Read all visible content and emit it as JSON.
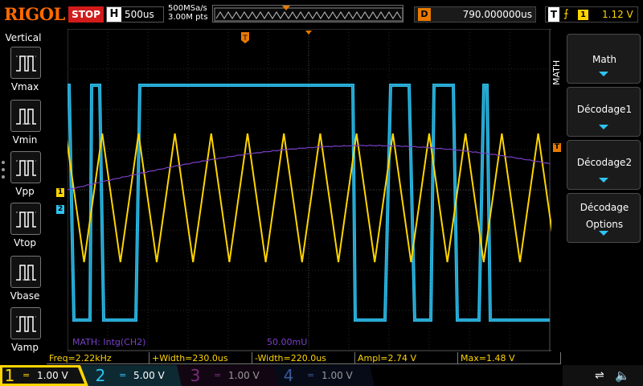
{
  "brand": "RIGOL",
  "status": "STOP",
  "horizontal": {
    "label": "H",
    "timebase": "500us"
  },
  "acquisition": {
    "sample_rate": "500MSa/s",
    "points": "3.00M pts"
  },
  "delay": {
    "label": "D",
    "value": "790.000000us"
  },
  "trigger": {
    "label": "T",
    "edge_icon": "rising-edge-icon",
    "source": "1",
    "level": "1.12 V"
  },
  "left_menu": {
    "title": "Vertical",
    "items": [
      {
        "label": "Vmax",
        "icon": "vmax-icon"
      },
      {
        "label": "Vmin",
        "icon": "vmin-icon"
      },
      {
        "label": "Vpp",
        "icon": "vpp-icon"
      },
      {
        "label": "Vtop",
        "icon": "vtop-icon"
      },
      {
        "label": "Vbase",
        "icon": "vbase-icon"
      },
      {
        "label": "Vamp",
        "icon": "vamp-icon"
      }
    ]
  },
  "right_menu": {
    "title": "MATH",
    "items": [
      {
        "label": "Math"
      },
      {
        "label": "Décodage1"
      },
      {
        "label": "Décodage2"
      },
      {
        "label": "Décodage",
        "label2": "Options"
      }
    ]
  },
  "math_trace": {
    "label": "MATH: Intg(CH2)",
    "scale": "50.00mU",
    "color": "#7a3fc7"
  },
  "markers": {
    "ch1": "1",
    "ch2": "2",
    "trigger_level": "T",
    "trigger_pos": "T"
  },
  "measurements": [
    {
      "label": "Freq=2.22kHz"
    },
    {
      "label": "+Width=230.0us"
    },
    {
      "label": "-Width=220.0us"
    },
    {
      "label": "Ampl=2.74 V"
    },
    {
      "label": "Max=1.48 V"
    }
  ],
  "channels": [
    {
      "num": "1",
      "coupling": "=",
      "scale": "1.00 V",
      "color": "#ffd500",
      "active": true
    },
    {
      "num": "2",
      "coupling": "=",
      "scale": "5.00 V",
      "color": "#2ec4f2",
      "active": true
    },
    {
      "num": "3",
      "coupling": "=",
      "scale": "1.00 V",
      "color": "#c23ac2",
      "active": false
    },
    {
      "num": "4",
      "coupling": "=",
      "scale": "1.00 V",
      "color": "#3a6fd8",
      "active": false
    }
  ],
  "colors": {
    "ch1": "#ffd500",
    "ch2": "#2ec4f2",
    "math": "#7a3fc7",
    "accent": "#e87a00",
    "stop": "#d21b1b"
  }
}
